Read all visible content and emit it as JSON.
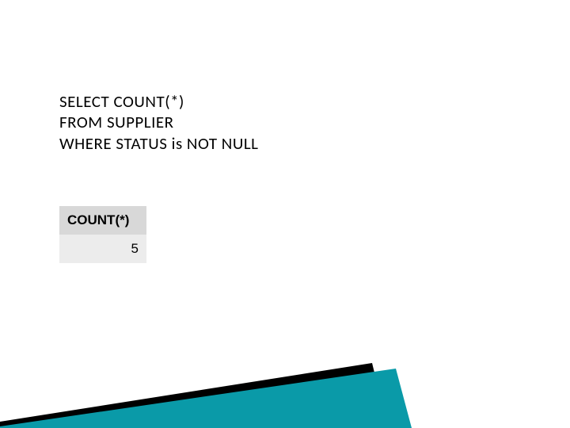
{
  "sql": {
    "line1": "SELECT COUNT(*)",
    "line2": "FROM SUPPLIER",
    "line3": "WHERE STATUS is NOT NULL"
  },
  "result": {
    "header": "COUNT(*)",
    "value": "5"
  }
}
